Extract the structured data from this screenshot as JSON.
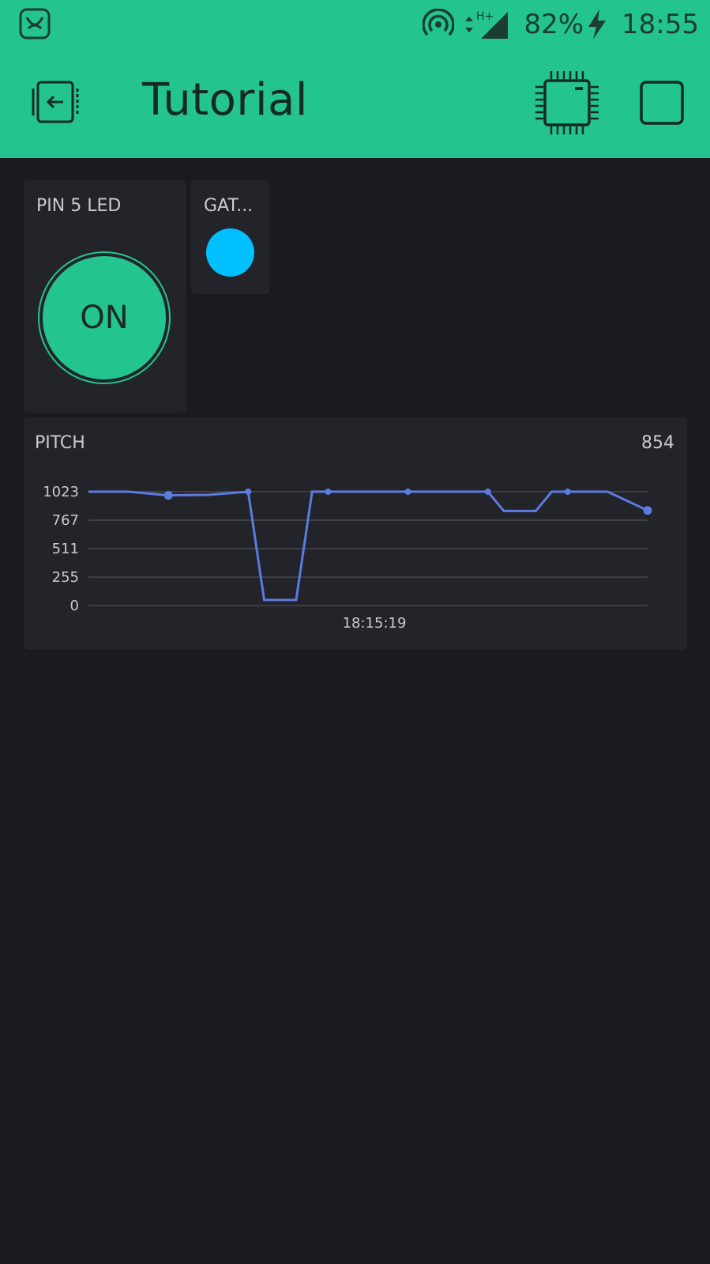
{
  "status_bar": {
    "battery": "82%",
    "time": "18:55",
    "network": "H+"
  },
  "app_bar": {
    "title": "Tutorial"
  },
  "widgets": {
    "led": {
      "label": "PIN 5 LED",
      "button_text": "ON"
    },
    "gat": {
      "label": "GAT...",
      "color": "#00c0ff"
    },
    "pitch": {
      "label": "PITCH",
      "value": "854"
    }
  },
  "colors": {
    "accent": "#23c48e",
    "background": "#1a1b20",
    "widget_bg": "#232429",
    "series": "#5b7be0"
  },
  "chart_data": {
    "type": "line",
    "title": "PITCH",
    "x": [
      0,
      1,
      2,
      3,
      4,
      5,
      6,
      7
    ],
    "xtick_label": "18:15:19",
    "yticks": [
      0,
      255,
      511,
      767,
      1023
    ],
    "ylim": [
      0,
      1023
    ],
    "series": [
      {
        "values_x": [
          0,
          0.5,
          1,
          1.5,
          2,
          2.2,
          2.6,
          2.8,
          3,
          3.5,
          4,
          4.5,
          5,
          5.2,
          5.6,
          5.8,
          6,
          6.5,
          7
        ],
        "values_y": [
          1023,
          1023,
          990,
          995,
          1023,
          50,
          50,
          1023,
          1023,
          1023,
          1023,
          1023,
          1023,
          850,
          850,
          1023,
          1023,
          1023,
          854
        ]
      }
    ],
    "markers_x": [
      1,
      2,
      3,
      4,
      5,
      6,
      7
    ],
    "grid": true
  }
}
